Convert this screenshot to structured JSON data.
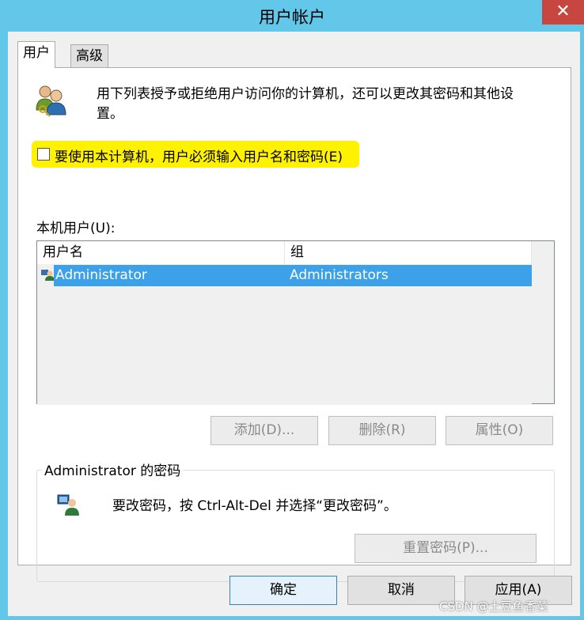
{
  "window": {
    "title": "用户帐户",
    "close_label": "✕"
  },
  "tabs": [
    {
      "label": "用户"
    },
    {
      "label": "高级"
    }
  ],
  "intro": {
    "text_line1": "用下列表授予或拒绝用户访问你的计算机，还可以更改其密码和其他设",
    "text_line2": "置。"
  },
  "require_login": {
    "label": "要使用本计算机，用户必须输入用户名和密码(E)",
    "checked": false,
    "highlight_color": "#fff200"
  },
  "local_users": {
    "label": "本机用户(U):",
    "columns": [
      "用户名",
      "组"
    ],
    "rows": [
      {
        "username": "Administrator",
        "group": "Administrators",
        "selected": true
      }
    ]
  },
  "user_buttons": {
    "add": "添加(D)...",
    "remove": "删除(R)",
    "properties": "属性(O)"
  },
  "password_group": {
    "legend": "Administrator 的密码",
    "message": "要改密码，按 Ctrl-Alt-Del 并选择“更改密码”。",
    "reset_button": "重置密码(P)..."
  },
  "dialog_buttons": {
    "ok": "确定",
    "cancel": "取消",
    "apply": "应用(A)"
  },
  "watermark": "CSDN @土豆鱼香菜",
  "colors": {
    "titlebar": "#63c7ea",
    "selection": "#3ca1e8",
    "close": "#c7463f"
  }
}
